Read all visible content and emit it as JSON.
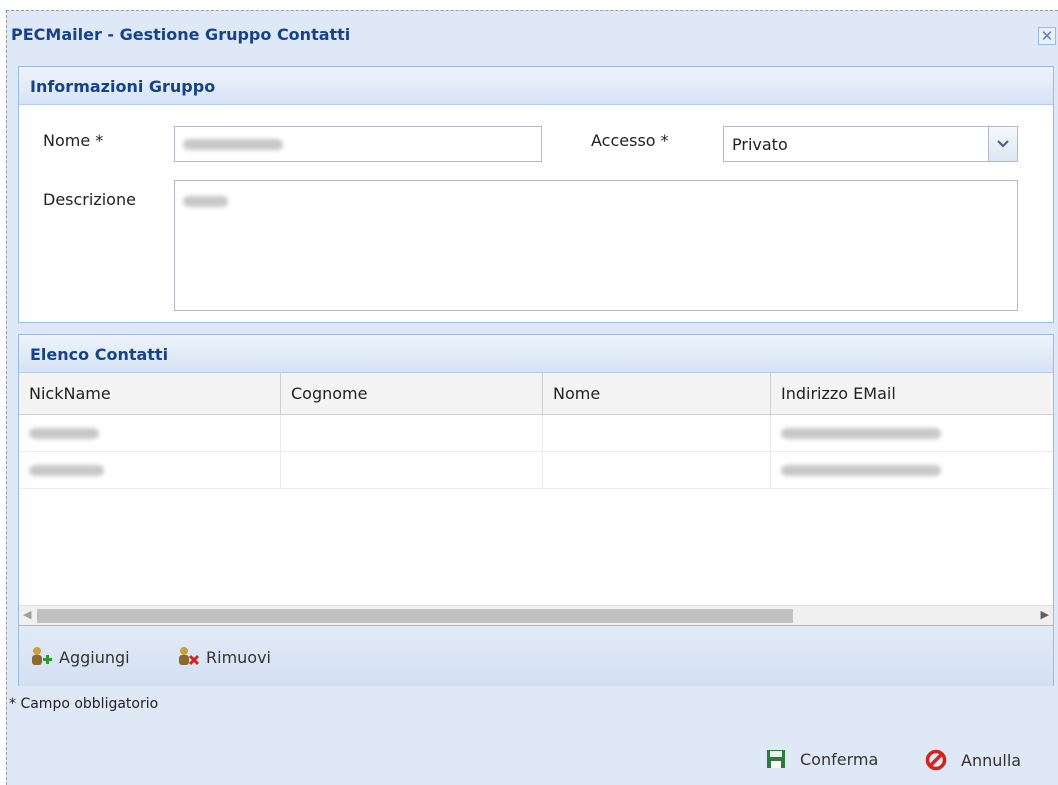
{
  "window": {
    "title": "PECMailer - Gestione Gruppo Contatti",
    "close_glyph": "✕"
  },
  "info": {
    "header": "Informazioni Gruppo",
    "name_label": "Nome *",
    "access_label": "Accesso *",
    "access_value": "Privato",
    "description_label": "Descrizione"
  },
  "contacts": {
    "header": "Elenco Contatti",
    "columns": [
      "NickName",
      "Cognome",
      "Nome",
      "Indirizzo EMail"
    ]
  },
  "toolbar": {
    "add_label": "Aggiungi",
    "remove_label": "Rimuovi"
  },
  "footnote": "* Campo obbligatorio",
  "footer": {
    "confirm_label": "Conferma",
    "cancel_label": "Annulla"
  },
  "colors": {
    "title": "#15428b",
    "panel_border": "#99bbe8",
    "window_bg": "#dfe8f6"
  }
}
